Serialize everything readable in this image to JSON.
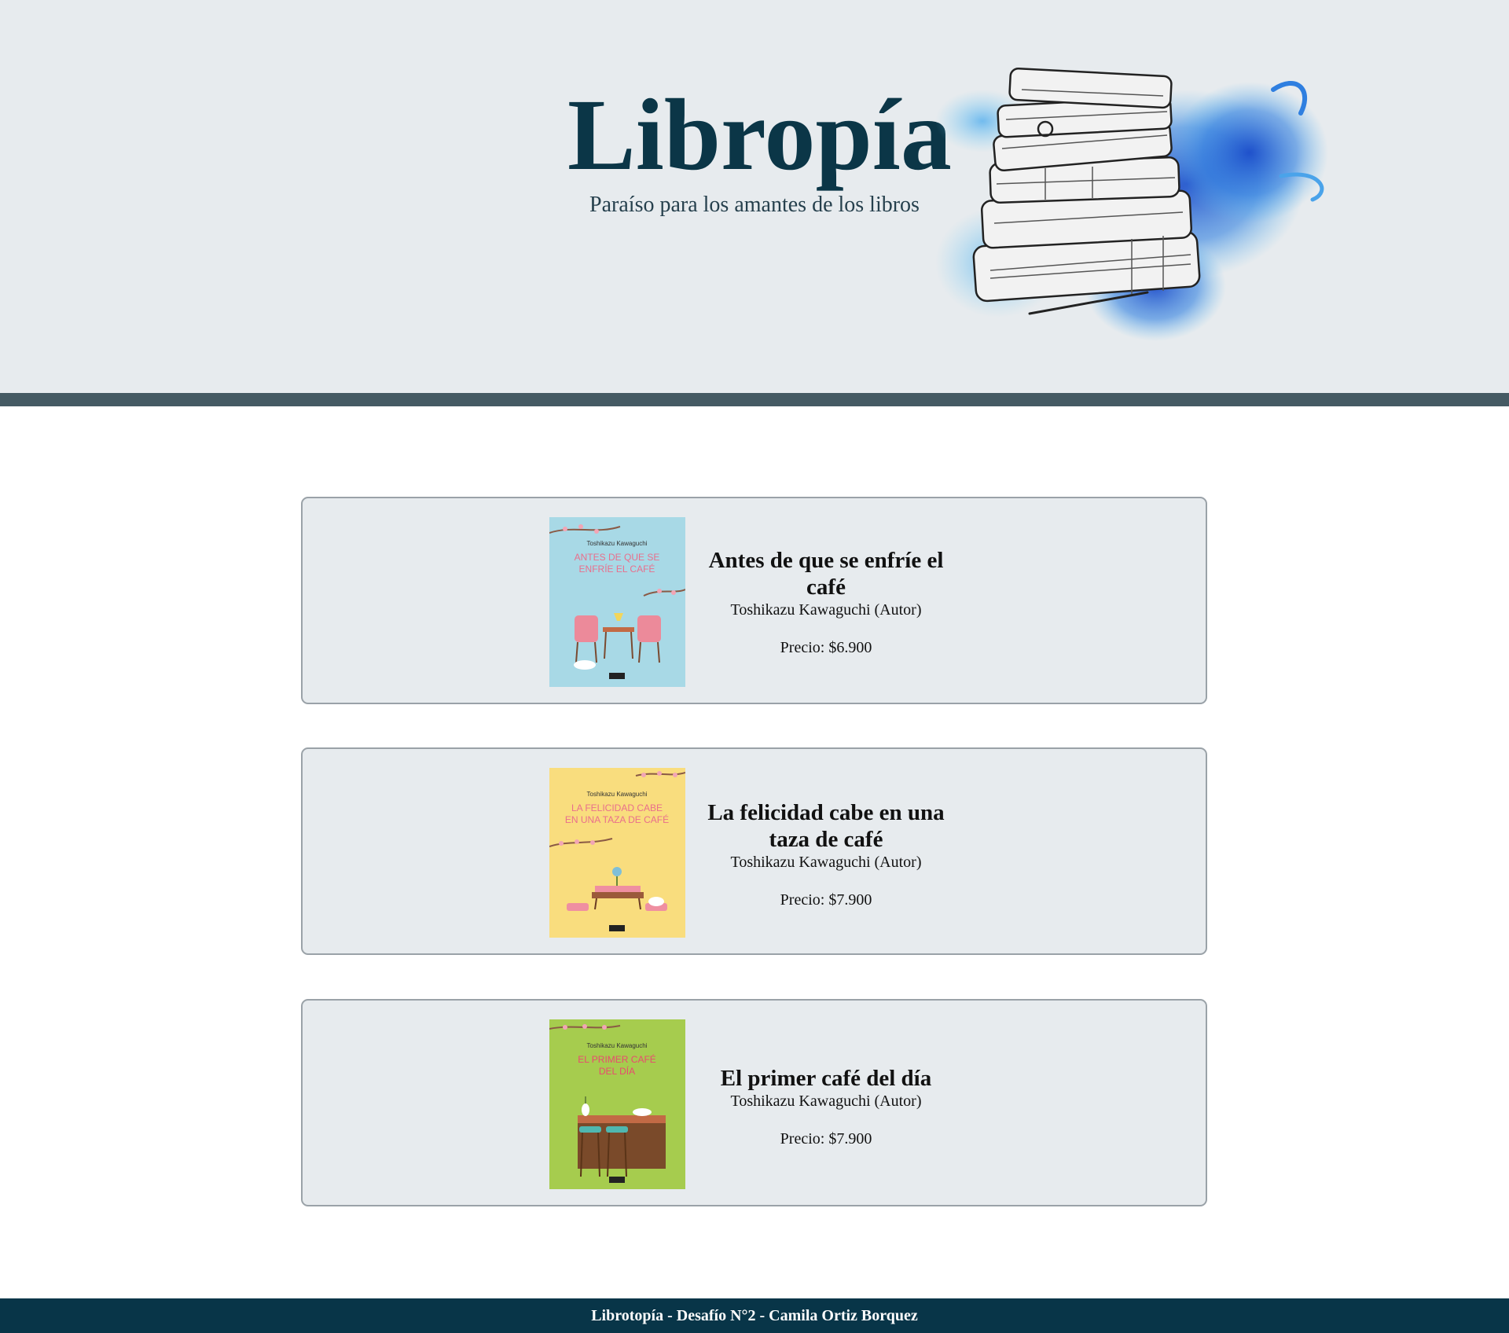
{
  "header": {
    "title": "Libropía",
    "tagline": "Paraíso para los amantes de los libros"
  },
  "books": [
    {
      "title": "Antes de que se enfríe el café",
      "author": "Toshikazu Kawaguchi (Autor)",
      "price": "Precio: $6.900",
      "cover": {
        "author": "Toshikazu Kawaguchi",
        "line1": "ANTES DE QUE SE",
        "line2": "ENFRÍE EL CAFÉ",
        "color": "#a8d9e6",
        "text_color": "#e96f8c"
      }
    },
    {
      "title": "La felicidad cabe en una taza de café",
      "author": "Toshikazu Kawaguchi (Autor)",
      "price": "Precio: $7.900",
      "cover": {
        "author": "Toshikazu Kawaguchi",
        "line1": "LA FELICIDAD CABE",
        "line2": "EN UNA TAZA DE CAFÉ",
        "color": "#f9dd7e",
        "text_color": "#e96f8c"
      }
    },
    {
      "title": "El primer café del día",
      "author": "Toshikazu Kawaguchi (Autor)",
      "price": "Precio: $7.900",
      "cover": {
        "author": "Toshikazu Kawaguchi",
        "line1": "EL PRIMER CAFÉ",
        "line2": "DEL DÍA",
        "color": "#a6cc4e",
        "text_color": "#e94a6f"
      }
    }
  ],
  "footer": {
    "text": "Librotopía - Desafío N°2 - Camila Ortiz Borquez"
  },
  "colors": {
    "header_bg": "#e7ebee",
    "rule": "#455a63",
    "title": "#0b3647",
    "footer_bg": "#083548",
    "smoke": "#2a6fd6"
  }
}
